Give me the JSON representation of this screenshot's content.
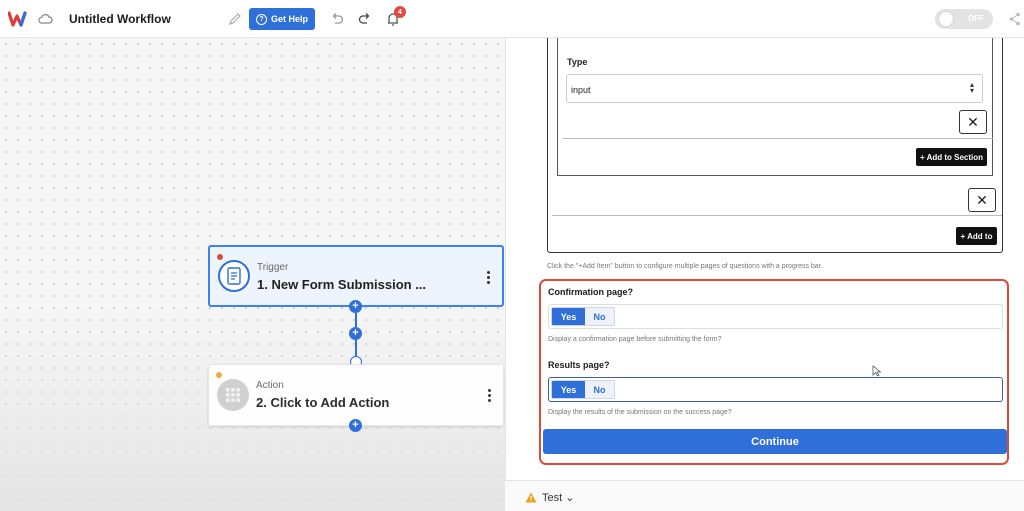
{
  "header": {
    "workflow_title": "Untitled Workflow",
    "help_label": "Get Help",
    "notification_count": "4",
    "toggle_label": "OFF"
  },
  "canvas": {
    "trigger": {
      "kind": "Trigger",
      "name": "1. New Form Submission ..."
    },
    "action": {
      "kind": "Action",
      "name": "2. Click to Add Action"
    }
  },
  "panel": {
    "type_label": "Type",
    "type_value": "input",
    "close_glyph": "✕",
    "add_to_section_label": "+ Add to Section",
    "add_to_label": "+ Add to",
    "add_item_hint": "Click the \"+Add Item\" button to configure multiple pages of questions with a progress bar.",
    "confirmation": {
      "label": "Confirmation page?",
      "yes": "Yes",
      "no": "No",
      "hint": "Display a confirmation page before submitting the form?"
    },
    "results": {
      "label": "Results page?",
      "yes": "Yes",
      "no": "No",
      "hint": "Display the results of the submission on the success page?"
    },
    "continue_label": "Continue",
    "test_label": "Test ⌄"
  },
  "colors": {
    "accent": "#2f6fd9",
    "highlight_border": "#d94b3a",
    "badge": "#e04a3f"
  },
  "icons": [
    "logo-icon",
    "cloud-icon",
    "pencil-icon",
    "help-icon",
    "undo-icon",
    "redo-icon",
    "bell-icon",
    "share-icon",
    "form-icon",
    "grid-icon",
    "warning-icon",
    "cursor-icon"
  ]
}
